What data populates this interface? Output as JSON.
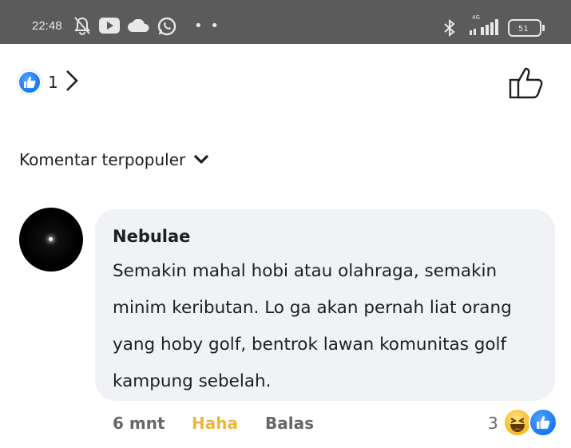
{
  "status_bar": {
    "time": "22:48",
    "icons": [
      "notifications-off-icon",
      "youtube-icon",
      "cloud-icon",
      "whatsapp-icon",
      "more-dots-icon",
      "bluetooth-icon",
      "signal-icon",
      "battery-icon"
    ],
    "network_label": "4G",
    "battery_level": "51"
  },
  "reactions": {
    "icon": "like-icon",
    "count": "1"
  },
  "sort": {
    "label": "Komentar terpopuler"
  },
  "comment": {
    "author": "Nebulae",
    "text": "Semakin mahal hobi atau olahraga, semakin minim keributan. Lo ga akan pernah liat orang yang hoby golf, bentrok lawan komunitas golf kampung sebelah.",
    "time": "6 mnt",
    "reaction_action": "Haha",
    "reply_action": "Balas",
    "reaction_count": "3",
    "reaction_icons": [
      "haha-icon",
      "like-icon"
    ]
  },
  "colors": {
    "status_bar_bg": "#5b5b5b",
    "bubble_bg": "#f0f2f5",
    "like_blue": "#1877f2",
    "haha_yellow": "#e9b73b",
    "secondary_text": "#65676b"
  }
}
